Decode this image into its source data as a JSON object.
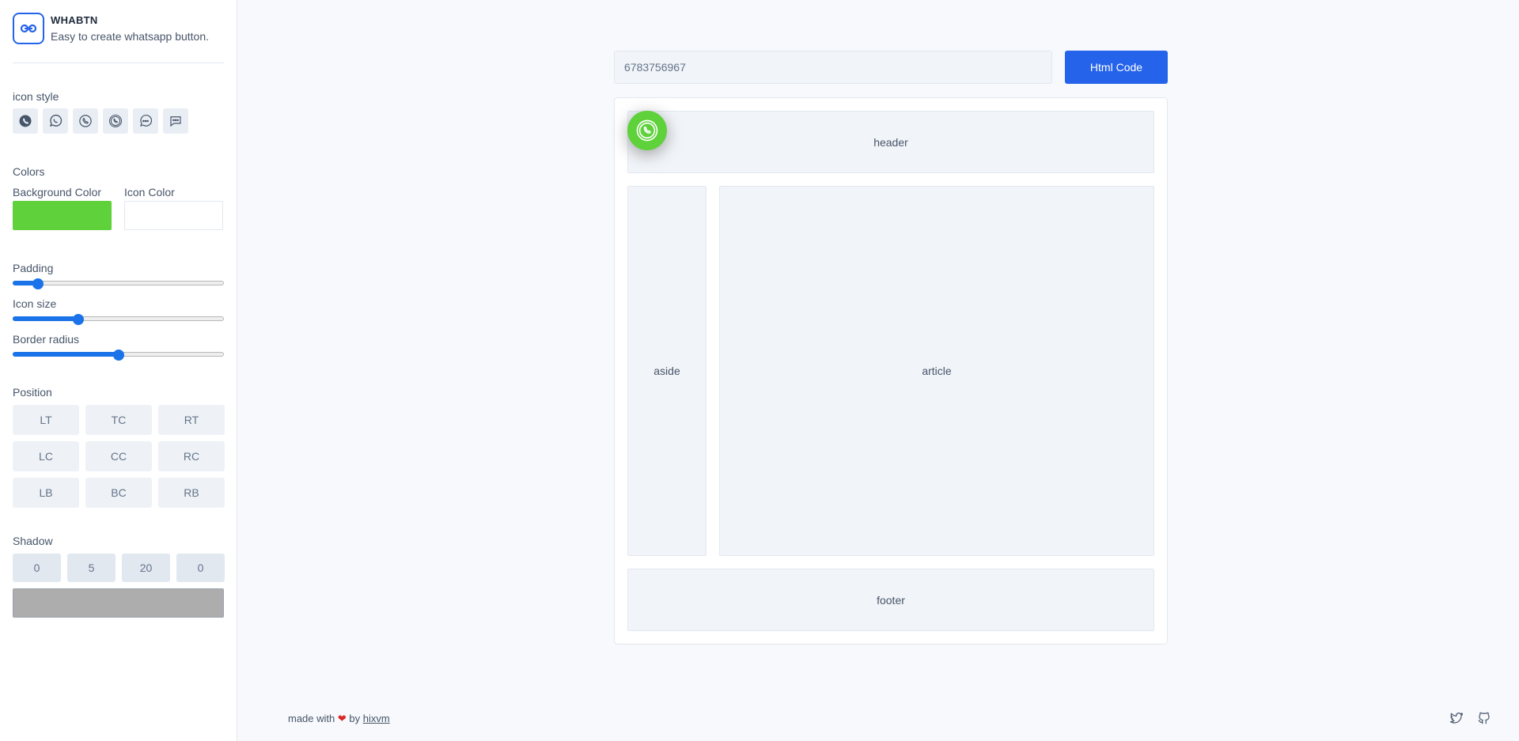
{
  "app": {
    "title": "WHABTN",
    "subtitle": "Easy to create whatsapp button."
  },
  "sidebar": {
    "icon_style_label": "icon style",
    "icon_styles": [
      "whatsapp-solid-icon",
      "whatsapp-outline-icon",
      "phone-bubble-icon",
      "whatsapp-double-icon",
      "chat-dots-round-icon",
      "chat-dots-square-icon"
    ],
    "colors_label": "Colors",
    "background_color_label": "Background Color",
    "background_color": "#5ed13b",
    "icon_color_label": "Icon Color",
    "icon_color": "#ffffff",
    "padding_label": "Padding",
    "padding_value": 0.12,
    "icon_size_label": "Icon size",
    "icon_size_value": 0.31,
    "border_radius_label": "Border radius",
    "border_radius_value": 0.5,
    "position_label": "Position",
    "positions": [
      "LT",
      "TC",
      "RT",
      "LC",
      "CC",
      "RC",
      "LB",
      "BC",
      "RB"
    ],
    "shadow_label": "Shadow",
    "shadow_values": [
      "0",
      "5",
      "20",
      "0"
    ],
    "shadow_color": "#adadad"
  },
  "main": {
    "phone_value": "6783756967",
    "html_button_label": "Html Code",
    "preview": {
      "header": "header",
      "aside": "aside",
      "article": "article",
      "footer": "footer"
    }
  },
  "footer": {
    "made_with": "made with",
    "heart": "❤",
    "by": "by",
    "author": "hixvm"
  },
  "colors": {
    "accent": "#2563eb",
    "whatsapp_green": "#5ed13b",
    "slider_blue": "#1a73e8"
  }
}
